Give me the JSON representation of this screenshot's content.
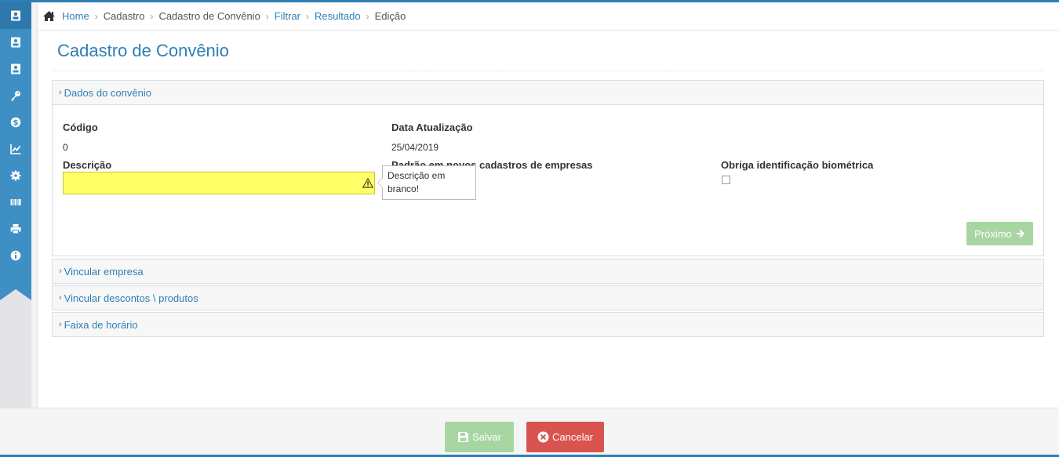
{
  "breadcrumb": {
    "home": "Home",
    "cadastro": "Cadastro",
    "cadastro_convenio": "Cadastro de Convênio",
    "filtrar": "Filtrar",
    "resultado": "Resultado",
    "edicao": "Edição"
  },
  "page": {
    "title": "Cadastro de Convênio"
  },
  "sidebar": {
    "items": [
      "contact-card-icon",
      "contact-card-icon",
      "contact-card-icon",
      "key-icon",
      "dollar-coin-icon",
      "line-chart-icon",
      "gear-icon",
      "barcode-icon",
      "printer-icon",
      "info-icon"
    ],
    "active_index": 0
  },
  "form": {
    "section_title": "Dados do convênio",
    "codigo_label": "Código",
    "codigo_value": "0",
    "data_label": "Data Atualização",
    "data_value": "25/04/2019",
    "descricao_label": "Descrição",
    "descricao_value": "",
    "descricao_error": "Descrição em branco!",
    "padrao_label": "Padrão em novos cadastros de empresas",
    "biometria_label": "Obriga identificação biométrica",
    "biometria_checked": false,
    "next_label": "Próximo"
  },
  "sections": [
    {
      "title": "Vincular empresa"
    },
    {
      "title": "Vincular descontos \\ produtos"
    },
    {
      "title": "Faixa de horário"
    }
  ],
  "footer": {
    "save_label": "Salvar",
    "cancel_label": "Cancelar"
  },
  "colors": {
    "primary": "#2f7fb5",
    "success_disabled": "#a8d6a3",
    "danger": "#d9534f",
    "invalid_field": "#ffff66"
  }
}
